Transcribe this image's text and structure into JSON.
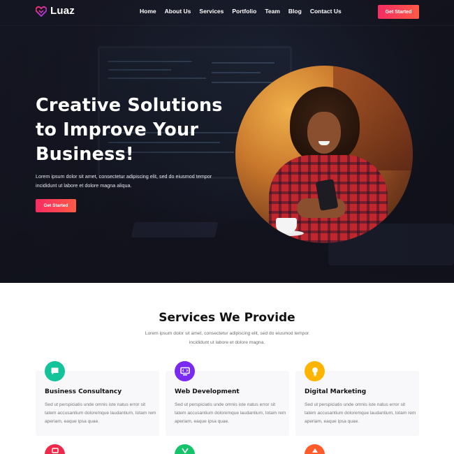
{
  "brand": {
    "name": "Luaz"
  },
  "nav": {
    "items": [
      "Home",
      "About Us",
      "Services",
      "Portfolio",
      "Team",
      "Blog",
      "Contact Us"
    ],
    "cta": "Get Started"
  },
  "hero": {
    "title": "Creative Solutions to Improve Your Business!",
    "subtitle": "Lorem ipsum dolor sit amet, consectetur adipiscing elit, sed do eiusmod tempor incididunt ut labore et dolore magna aliqua.",
    "cta": "Get Started"
  },
  "services": {
    "title": "Services We Provide",
    "subtitle": "Lorem ipsum dolor sit amet, consectetur adipiscing elit, sed do eiusmod tempor incididunt ut labore et dolore magna.",
    "cards": [
      {
        "title": "Business Consultancy",
        "text": "Sed ut perspiciatis unde omnis iste natus error sit tatem accusantium doloremque laudantium, totam rem aperiam, eaque ipsa quae.",
        "icon": "chat-bubble-icon",
        "color": "#13c49a"
      },
      {
        "title": "Web Development",
        "text": "Sed ut perspiciatis unde omnis iste natus error sit tatem accusantium doloremque laudantium, totam rem aperiam, eaque ipsa quae.",
        "icon": "monitor-icon",
        "color": "#7a29f0"
      },
      {
        "title": "Digital Marketing",
        "text": "Sed ut perspiciatis unde omnis iste natus error sit tatem accusantium doloremque laudantium, totam rem aperiam, eaque ipsa quae.",
        "icon": "lightbulb-icon",
        "color": "#ffb400"
      }
    ],
    "next_row_icon_colors": [
      "#f0284a",
      "#13c46a",
      "#ff5a2a"
    ]
  },
  "colors": {
    "accent_gradient_start": "#f72c63",
    "accent_gradient_end": "#ff5a45",
    "hero_bg": "#14151f"
  }
}
